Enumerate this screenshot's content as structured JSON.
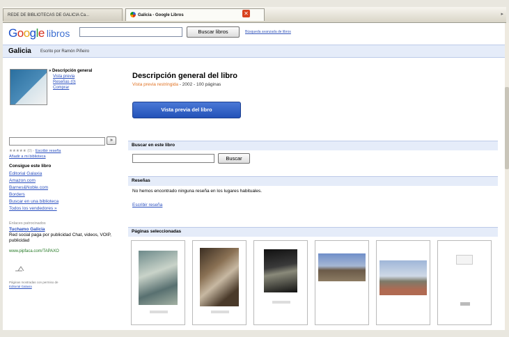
{
  "browser": {
    "tabs": [
      {
        "label": "REDE DE BIBLIOTECAS DE GALICIA Ca..."
      },
      {
        "label": "Galicia - Google Libros"
      }
    ]
  },
  "header": {
    "logo": "Google",
    "product": "libros",
    "search_value": "",
    "search_button": "Buscar libros",
    "advanced_link": "Búsqueda avanzada de libros"
  },
  "book": {
    "title": "Galicia",
    "author": "Escrito por Ramón Piñeiro"
  },
  "left_nav": {
    "overview": "» Descripción general",
    "links": [
      "Vista previa",
      "Reseñas (0)",
      "Comprar"
    ],
    "search_button": "»",
    "rating_stars": "★★★★★",
    "rating_count": "(0)",
    "write_review": "Escribir reseña",
    "add_library": "Añadir a mi biblioteca",
    "get_heading": "Consigue este libro",
    "get_links": [
      "Editorial Galaxia",
      "Amazon.com",
      "Barnes&Noble.com",
      "Borders",
      "Buscar en una biblioteca",
      "Todos los vendedores »"
    ],
    "sponsored_heading": "Enlaces patrocinados",
    "sponsored_title": "Tuchamo Galicia",
    "sponsored_text": "Red social paga por publicidad Chat, videos, VOIP, publicidad",
    "sponsored_url": "www.pipfaca.com/TAPAXO",
    "publisher_note": "Páginas mostradas con permiso de",
    "publisher_link": "Editorial Galaxia"
  },
  "main": {
    "desc_title": "Descripción general del libro",
    "limited_preview": "Vista previa restringida",
    "year_pages": " - 2002 - 100 páginas",
    "preview_button": "Vista previa del libro",
    "search_section": "Buscar en este libro",
    "search_button": "Buscar",
    "reviews_section": "Reseñas",
    "no_reviews": "No hemos encontrado ninguna reseña en los lugares habituales.",
    "write_review": "Escribir reseña",
    "pages_section": "Páginas seleccionadas"
  },
  "colors": {
    "link": "#2a4fbf",
    "section_bg": "#e5ecf9",
    "preview_button": "#2f5fc4",
    "limited_preview": "#e07020"
  }
}
